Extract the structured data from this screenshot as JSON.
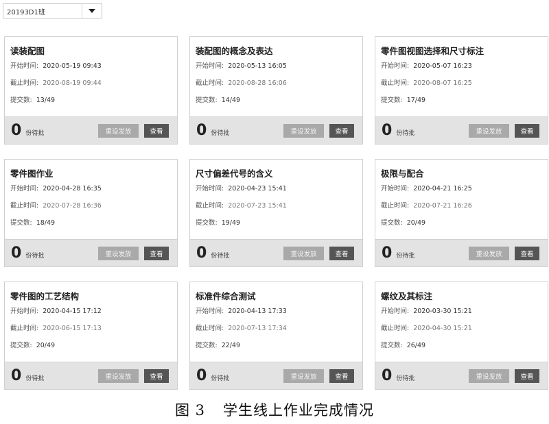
{
  "class_select": {
    "value": "20193D1班"
  },
  "cards": [
    {
      "title": "读装配图",
      "start_label": "开始时间:",
      "start": "2020-05-19 09:43",
      "end_label": "截止时间:",
      "end": "2020-08-19 09:44",
      "submit_label": "提交数:",
      "submit": "13/49",
      "pending": "0",
      "pending_label": "份待批",
      "reset_label": "重设发放",
      "view_label": "查看"
    },
    {
      "title": "装配图的概念及表达",
      "start_label": "开始时间:",
      "start": "2020-05-13 16:05",
      "end_label": "截止时间:",
      "end": "2020-08-28 16:06",
      "submit_label": "提交数:",
      "submit": "14/49",
      "pending": "0",
      "pending_label": "份待批",
      "reset_label": "重设发放",
      "view_label": "查看"
    },
    {
      "title": "零件图视图选择和尺寸标注",
      "start_label": "开始时间:",
      "start": "2020-05-07 16:23",
      "end_label": "截止时间:",
      "end": "2020-08-07 16:25",
      "submit_label": "提交数:",
      "submit": "17/49",
      "pending": "0",
      "pending_label": "份待批",
      "reset_label": "重设发放",
      "view_label": "查看"
    },
    {
      "title": "零件图作业",
      "start_label": "开始时间:",
      "start": "2020-04-28 16:35",
      "end_label": "截止时间:",
      "end": "2020-07-28 16:36",
      "submit_label": "提交数:",
      "submit": "18/49",
      "pending": "0",
      "pending_label": "份待批",
      "reset_label": "重设发放",
      "view_label": "查看"
    },
    {
      "title": "尺寸偏差代号的含义",
      "start_label": "开始时间:",
      "start": "2020-04-23 15:41",
      "end_label": "截止时间:",
      "end": "2020-07-23 15:41",
      "submit_label": "提交数:",
      "submit": "19/49",
      "pending": "0",
      "pending_label": "份待批",
      "reset_label": "重设发放",
      "view_label": "查看"
    },
    {
      "title": "极限与配合",
      "start_label": "开始时间:",
      "start": "2020-04-21 16:25",
      "end_label": "截止时间:",
      "end": "2020-07-21 16:26",
      "submit_label": "提交数:",
      "submit": "20/49",
      "pending": "0",
      "pending_label": "份待批",
      "reset_label": "重设发放",
      "view_label": "查看"
    },
    {
      "title": "零件图的工艺结构",
      "start_label": "开始时间:",
      "start": "2020-04-15 17:12",
      "end_label": "截止时间:",
      "end": "2020-06-15 17:13",
      "submit_label": "提交数:",
      "submit": "20/49",
      "pending": "0",
      "pending_label": "份待批",
      "reset_label": "重设发放",
      "view_label": "查看"
    },
    {
      "title": "标准件综合测试",
      "start_label": "开始时间:",
      "start": "2020-04-13 17:33",
      "end_label": "截止时间:",
      "end": "2020-07-13 17:34",
      "submit_label": "提交数:",
      "submit": "22/49",
      "pending": "0",
      "pending_label": "份待批",
      "reset_label": "重设发放",
      "view_label": "查看"
    },
    {
      "title": "螺纹及其标注",
      "start_label": "开始时间:",
      "start": "2020-03-30 15:21",
      "end_label": "截止时间:",
      "end": "2020-04-30 15:21",
      "submit_label": "提交数:",
      "submit": "26/49",
      "pending": "0",
      "pending_label": "份待批",
      "reset_label": "重设发放",
      "view_label": "查看"
    }
  ],
  "caption": {
    "figure_no": "图 3",
    "text": "学生线上作业完成情况"
  },
  "icons": {
    "dropdown": "caret-down-icon"
  }
}
